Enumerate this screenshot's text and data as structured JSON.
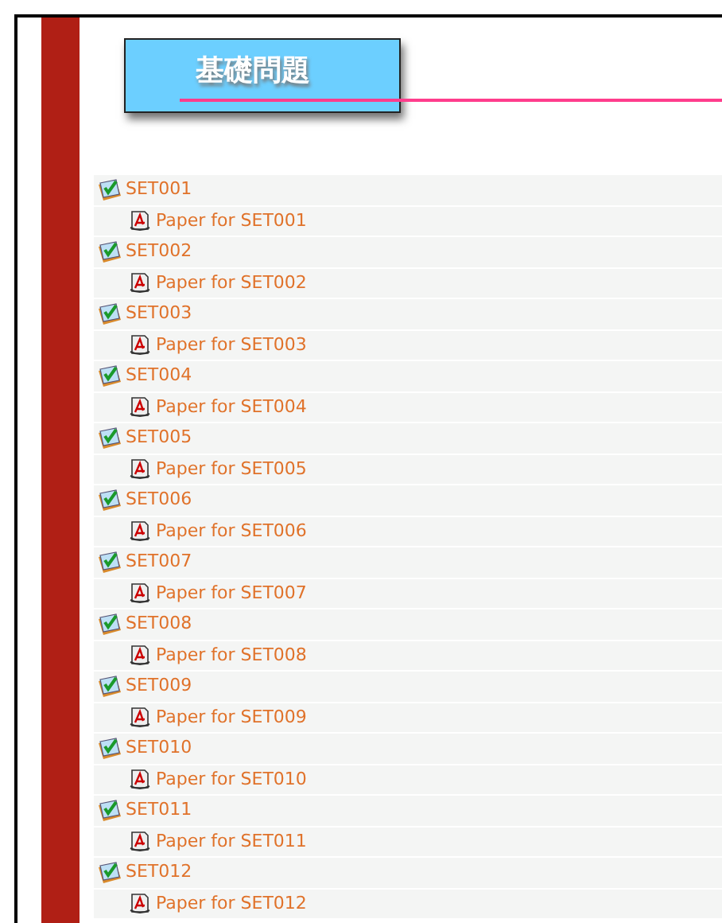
{
  "heading": "基礎問題",
  "sets": [
    {
      "label": "SET001",
      "children": [
        {
          "label": "Paper for SET001"
        }
      ]
    },
    {
      "label": "SET002",
      "children": [
        {
          "label": "Paper for SET002"
        }
      ]
    },
    {
      "label": "SET003",
      "children": [
        {
          "label": "Paper for SET003"
        }
      ]
    },
    {
      "label": "SET004",
      "children": [
        {
          "label": "Paper for SET004"
        }
      ]
    },
    {
      "label": "SET005",
      "children": [
        {
          "label": "Paper for SET005"
        }
      ]
    },
    {
      "label": "SET006",
      "children": [
        {
          "label": "Paper for SET006"
        }
      ]
    },
    {
      "label": "SET007",
      "children": [
        {
          "label": "Paper for SET007"
        }
      ]
    },
    {
      "label": "SET008",
      "children": [
        {
          "label": "Paper for SET008"
        }
      ]
    },
    {
      "label": "SET009",
      "children": [
        {
          "label": "Paper for SET009"
        }
      ]
    },
    {
      "label": "SET010",
      "children": [
        {
          "label": "Paper for SET010"
        }
      ]
    },
    {
      "label": "SET011",
      "children": [
        {
          "label": "Paper for SET011"
        }
      ]
    },
    {
      "label": "SET012",
      "children": [
        {
          "label": "Paper for SET012"
        }
      ]
    }
  ]
}
